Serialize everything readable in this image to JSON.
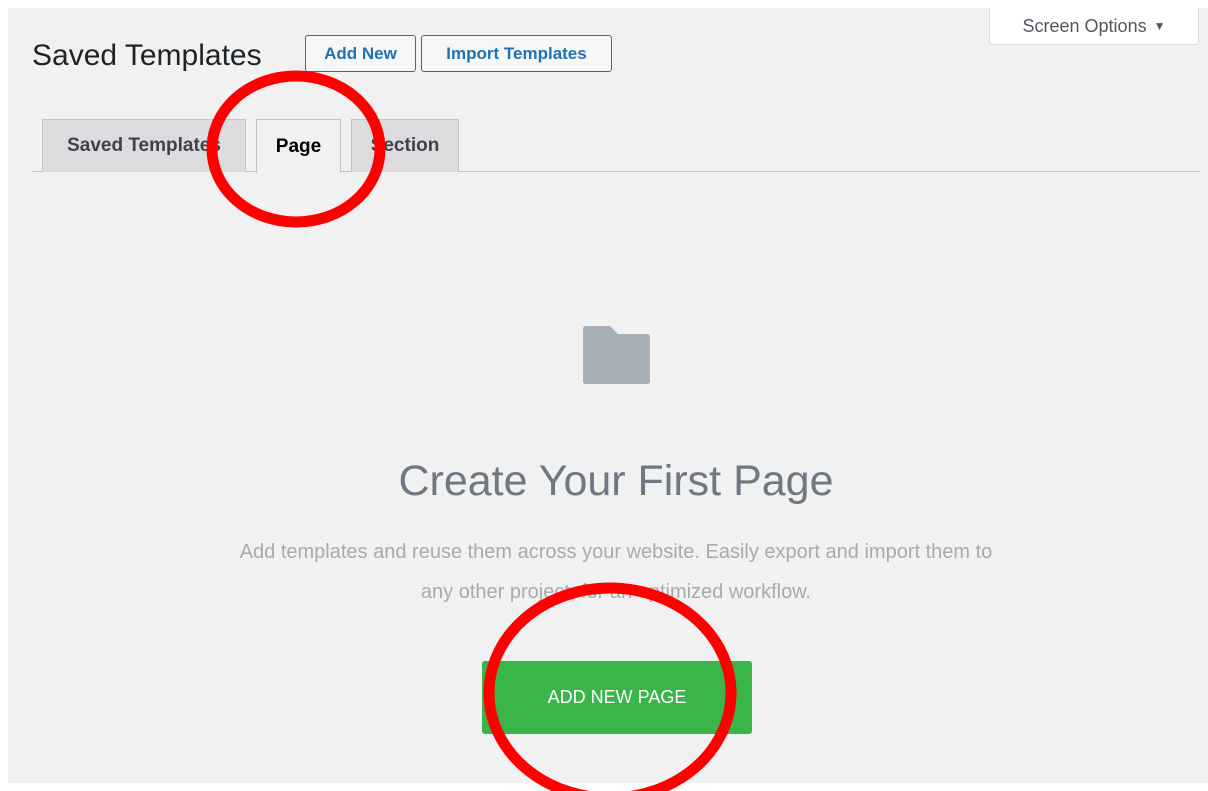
{
  "header": {
    "title": "Saved Templates",
    "add_new_label": "Add New",
    "import_label": "Import Templates",
    "screen_options_label": "Screen Options",
    "screen_options_arrow": "▼"
  },
  "tabs": [
    {
      "label": "Saved Templates",
      "active": false
    },
    {
      "label": "Page",
      "active": true
    },
    {
      "label": "Section",
      "active": false
    }
  ],
  "empty_state": {
    "icon": "folder-icon",
    "title": "Create Your First Page",
    "text": "Add templates and reuse them across your website. Easily export and import them to any other project, for an optimized workflow.",
    "button_label": "ADD NEW PAGE"
  },
  "colors": {
    "accent": "#2271b1",
    "button_green": "#39b54a",
    "folder_gray": "#a4afb7",
    "annotation_red": "#ff0000"
  },
  "annotations": [
    {
      "name": "page-tab-highlight-circle",
      "shape": "ellipse",
      "color": "#ff0000"
    },
    {
      "name": "add-page-button-highlight-circle",
      "shape": "ellipse",
      "color": "#ff0000"
    }
  ]
}
